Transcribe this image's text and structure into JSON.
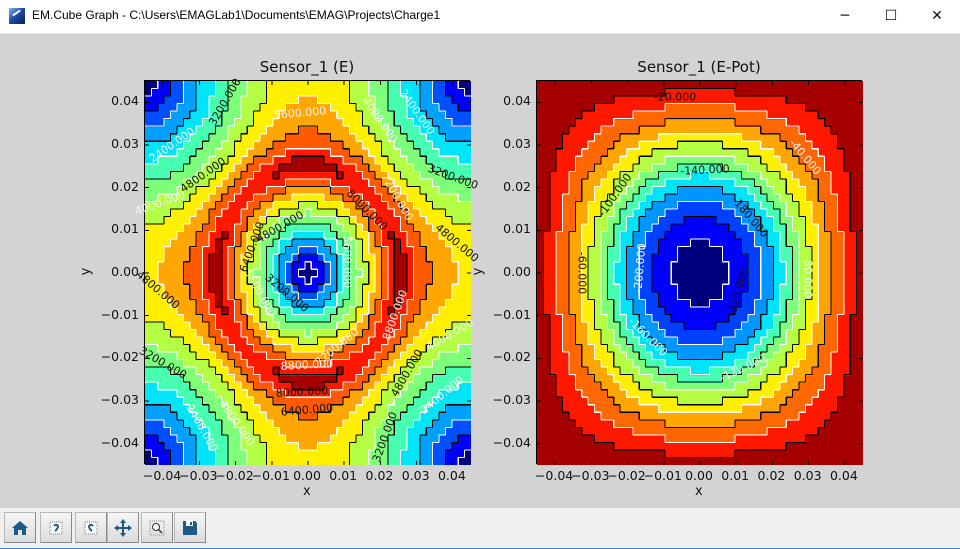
{
  "window": {
    "title": "EM.Cube Graph - C:\\Users\\EMAGLab1\\Documents\\EMAG\\Projects\\Charge1",
    "controls": {
      "minimize": "─",
      "maximize": "☐",
      "close": "✕"
    }
  },
  "toolbar": {
    "buttons": [
      {
        "icon": "home-icon"
      },
      {
        "icon": "back-icon"
      },
      {
        "icon": "forward-icon"
      },
      {
        "icon": "pan-icon"
      },
      {
        "icon": "zoom-icon"
      },
      {
        "icon": "save-icon"
      }
    ]
  },
  "chart_data": [
    {
      "type": "contour",
      "title": "Sensor_1 (E)",
      "xlabel": "x",
      "ylabel": "y",
      "xlim": [
        -0.045,
        0.045
      ],
      "ylim": [
        -0.045,
        0.045
      ],
      "xticks": [
        "−0.04",
        "−0.03",
        "−0.02",
        "−0.01",
        "0.00",
        "0.01",
        "0.02",
        "0.03",
        "0.04"
      ],
      "yticks": [
        "0.04",
        "0.03",
        "0.02",
        "0.01",
        "0.00",
        "−0.01",
        "−0.02",
        "−0.03",
        "−0.04"
      ],
      "levels": {
        "start": 0,
        "step": 800,
        "count": 13
      },
      "value_range": [
        0,
        9800
      ],
      "colormap": "jet",
      "colors": [
        "#00007f",
        "#0000ff",
        "#0050ff",
        "#00a0ff",
        "#00e4f8",
        "#46ffb0",
        "#7dff7a",
        "#b4ff43",
        "#fff000",
        "#ffa600",
        "#ff5a00",
        "#ff1800",
        "#a40000"
      ],
      "line_colors": {
        "even_level": "#000000",
        "odd_level": "#ffffff"
      },
      "contour_labels": [
        "5600.000",
        "3200.000",
        "2400.000",
        "4800.000",
        "4000.000",
        "4800.000",
        "3200.000",
        "4000.000",
        "2400.000",
        "6400.000",
        "8000.000",
        "8800.000",
        "7200.000",
        "8800.000",
        "4000.000",
        "4800.000",
        "2400.000",
        "3200.000",
        "4000.000",
        "2400.000",
        "3200.000",
        "7200.000",
        "8000.000",
        "4800.000",
        "5600.000",
        "4800.000",
        "6400.000",
        "3200.000",
        "5600.000"
      ]
    },
    {
      "type": "contour",
      "title": "Sensor_1 (E-Pot)",
      "xlabel": "x",
      "ylabel": "y",
      "xlim": [
        -0.045,
        0.045
      ],
      "ylim": [
        -0.045,
        0.045
      ],
      "xticks": [
        "−0.04",
        "−0.03",
        "−0.02",
        "−0.01",
        "0.00",
        "0.01",
        "0.02",
        "0.03",
        "0.04"
      ],
      "yticks": [
        "0.04",
        "0.03",
        "0.02",
        "0.01",
        "0.00",
        "−0.01",
        "−0.02",
        "−0.03",
        "−0.04"
      ],
      "levels": {
        "start": -260,
        "step": 20,
        "count": 13
      },
      "value_range": [
        -250,
        0
      ],
      "colormap": "jet",
      "colors": [
        "#00007f",
        "#0000ff",
        "#0040ff",
        "#0096ff",
        "#00e4f8",
        "#46ffb0",
        "#7dff7a",
        "#b4ff43",
        "#fff000",
        "#ffa600",
        "#ff6800",
        "#ff1800",
        "#a40000"
      ],
      "line_colors": {
        "even_level": "#000000",
        "odd_level": "#ffffff"
      },
      "contour_labels": [
        "-20.000",
        "-40.000",
        "-140.000",
        "-100.000",
        "-180.000",
        "-60.000",
        "-200.000",
        "-220.000",
        "-80.000",
        "-160.000",
        "-120.000"
      ]
    }
  ]
}
